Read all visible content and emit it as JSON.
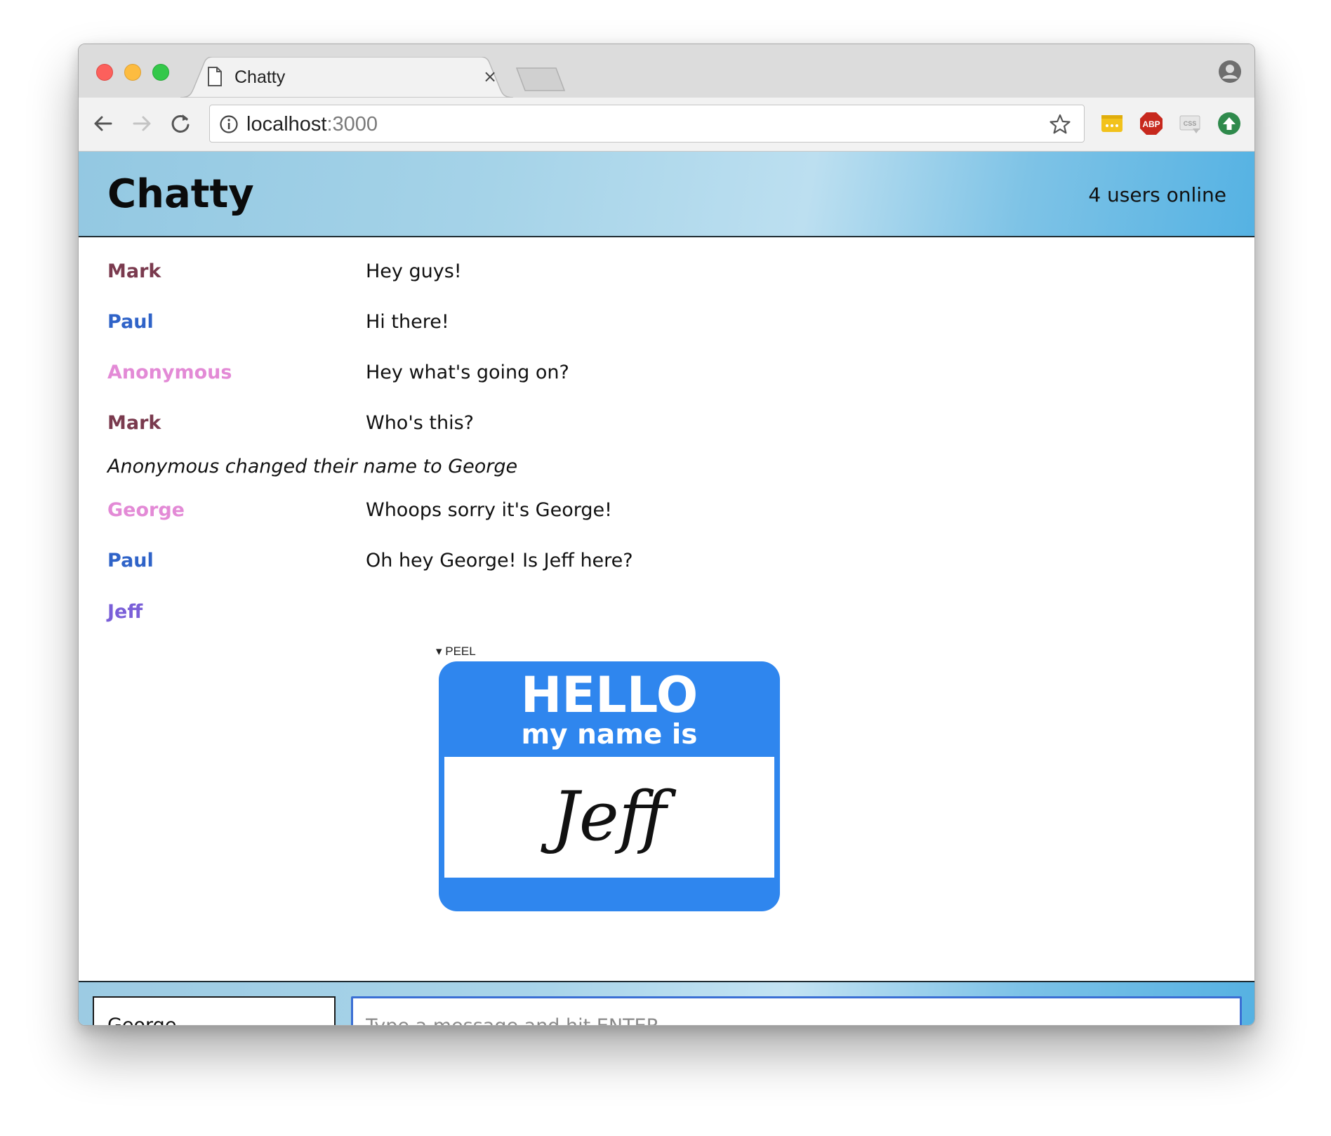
{
  "browser": {
    "tab_title": "Chatty",
    "tab_close": "×",
    "url_host": "localhost",
    "url_port": ":3000",
    "extensions": [
      "password-manager-icon",
      "adblock-plus-icon",
      "css-viewer-icon",
      "upload-extension-icon"
    ],
    "abp_label": "ABP",
    "css_label": "CSS"
  },
  "header": {
    "title": "Chatty",
    "users_online": "4 users online"
  },
  "messages": [
    {
      "username": "Mark",
      "content": "Hey guys!",
      "color": "#7a3a4e"
    },
    {
      "username": "Paul",
      "content": "Hi there!",
      "color": "#2f63c8"
    },
    {
      "username": "Anonymous",
      "content": "Hey what's going on?",
      "color": "#e38ad6"
    },
    {
      "username": "Mark",
      "content": "Who's this?",
      "color": "#7a3a4e"
    }
  ],
  "notification": "Anonymous changed their name to George",
  "messages_after": [
    {
      "username": "George",
      "content": "Whoops sorry it's George!",
      "color": "#e38ad6"
    },
    {
      "username": "Paul",
      "content": "Oh hey George! Is Jeff here?",
      "color": "#2f63c8"
    },
    {
      "username": "Jeff",
      "color": "#7a5fd8"
    }
  ],
  "sticker": {
    "peel_label": "▾ PEEL",
    "hello": "HELLO",
    "subtitle": "my name is",
    "name": "Jeff"
  },
  "composer": {
    "username_value": "George",
    "message_placeholder": "Type a message and hit ENTER"
  },
  "colors": {
    "header_gradient_start": "#93c8e2",
    "header_gradient_end": "#55b2e3",
    "sticker_blue": "#2f86ee",
    "input_focus_border": "#3b6fd4"
  }
}
